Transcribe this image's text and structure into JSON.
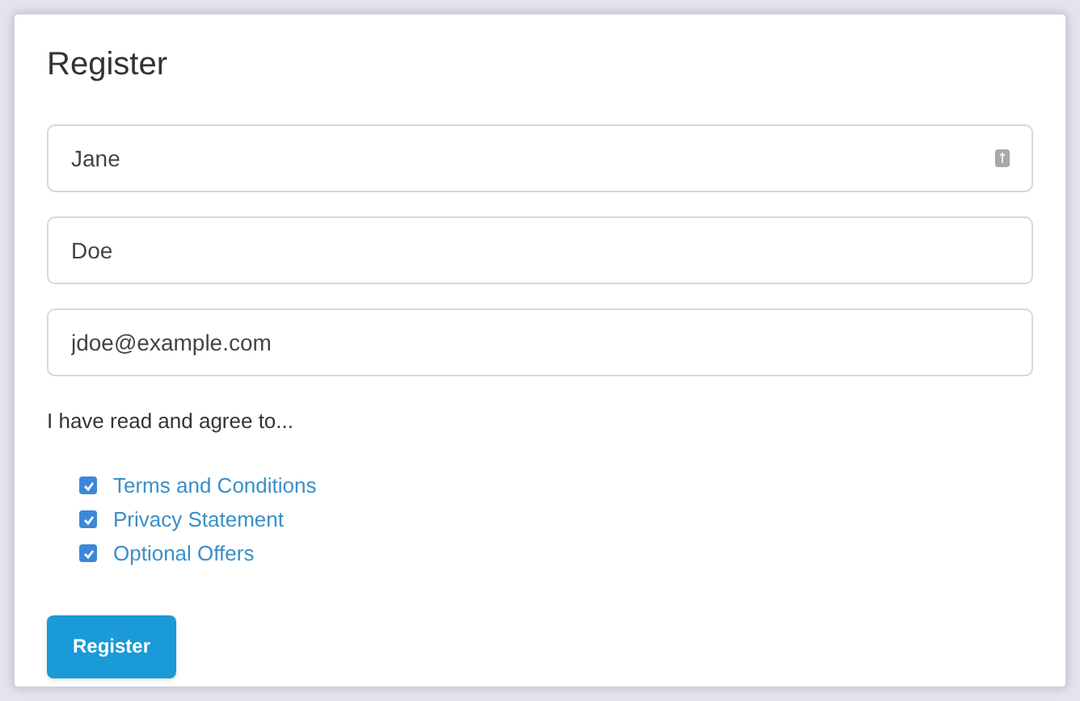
{
  "title": "Register",
  "fields": [
    {
      "value": "Jane",
      "autofill_icon": true
    },
    {
      "value": "Doe",
      "autofill_icon": false
    },
    {
      "value": "jdoe@example.com",
      "autofill_icon": false
    }
  ],
  "agreement_label": "I have read and agree to...",
  "options": [
    {
      "label": "Terms and Conditions",
      "checked": true
    },
    {
      "label": "Privacy Statement",
      "checked": true
    },
    {
      "label": "Optional Offers",
      "checked": true
    }
  ],
  "submit_button": "Register"
}
